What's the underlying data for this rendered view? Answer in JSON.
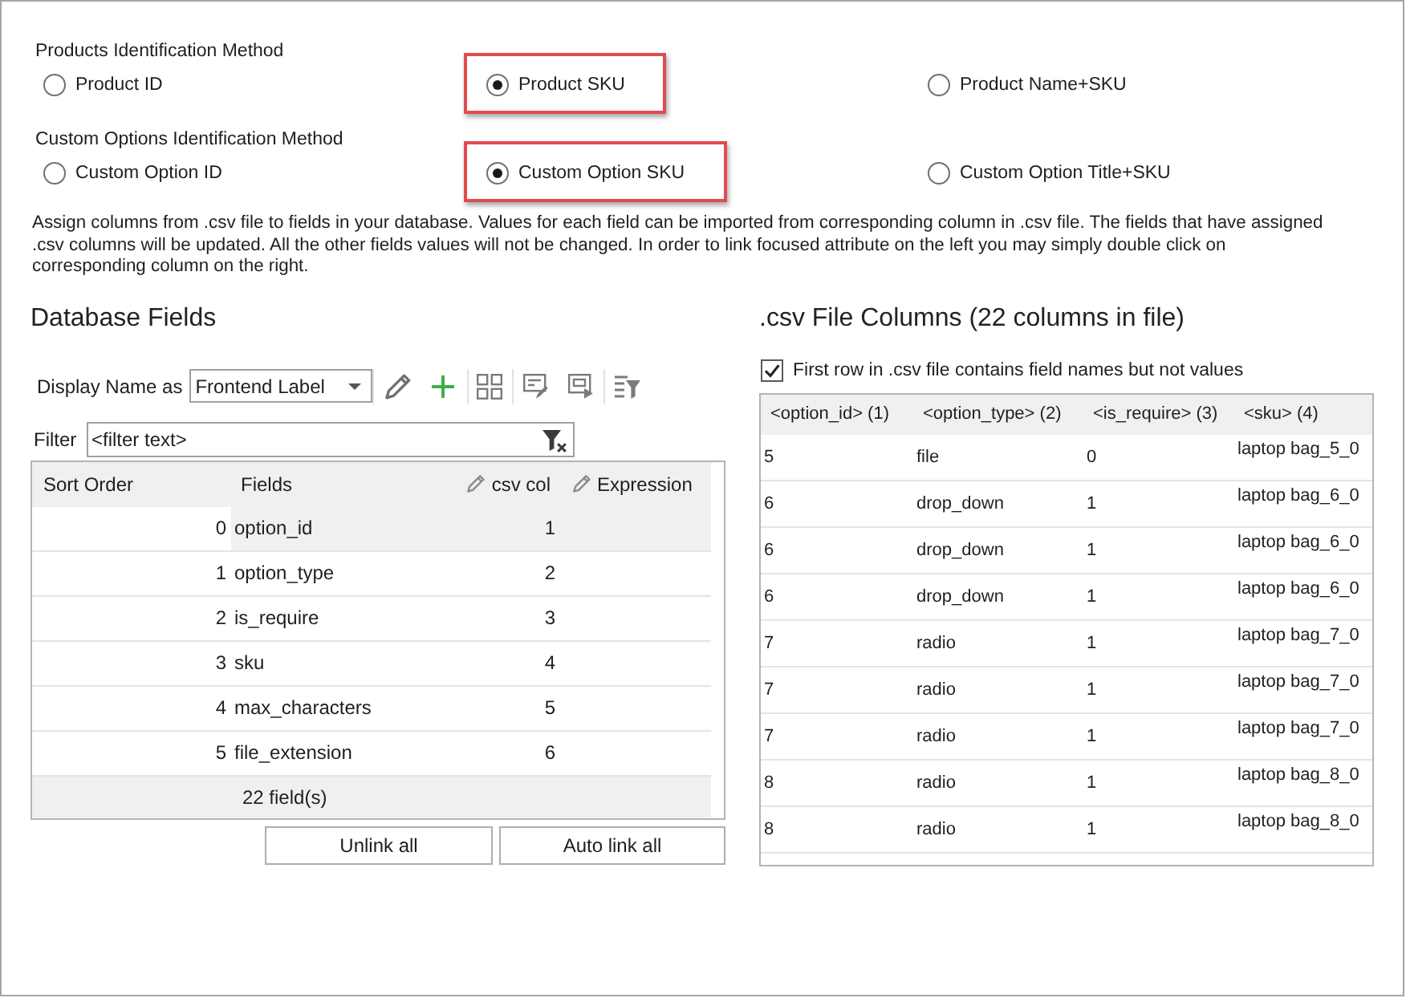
{
  "product_identification": {
    "label": "Products Identification Method",
    "options": [
      {
        "label": "Product ID",
        "selected": false,
        "highlighted": false
      },
      {
        "label": "Product SKU",
        "selected": true,
        "highlighted": true
      },
      {
        "label": "Product Name+SKU",
        "selected": false,
        "highlighted": false
      }
    ]
  },
  "custom_option_identification": {
    "label": "Custom Options Identification Method",
    "options": [
      {
        "label": "Custom Option ID",
        "selected": false,
        "highlighted": false
      },
      {
        "label": "Custom Option SKU",
        "selected": true,
        "highlighted": true
      },
      {
        "label": "Custom Option Title+SKU",
        "selected": false,
        "highlighted": false
      }
    ]
  },
  "instructions": "Assign columns from .csv file to fields in your database. Values for each field can be imported from corresponding column in .csv file. The fields that have assigned .csv columns will be updated. All the other fields values will not be changed. In order to link focused attribute on the left you may simply double click on corresponding column on the right.",
  "database_fields": {
    "title": "Database Fields",
    "display_name": {
      "label": "Display Name as",
      "value": "Frontend Label"
    },
    "filter": {
      "label": "Filter",
      "placeholder": "<filter text>"
    },
    "columns": [
      {
        "label": "Sort Order",
        "editable": false
      },
      {
        "label": "Fields",
        "editable": false
      },
      {
        "label": "csv col",
        "editable": true
      },
      {
        "label": "Expression",
        "editable": true
      }
    ],
    "rows": [
      {
        "sort_order": "0",
        "field": "option_id",
        "csv_col": "1",
        "selected": true
      },
      {
        "sort_order": "1",
        "field": "option_type",
        "csv_col": "2",
        "selected": false
      },
      {
        "sort_order": "2",
        "field": "is_require",
        "csv_col": "3",
        "selected": false
      },
      {
        "sort_order": "3",
        "field": "sku",
        "csv_col": "4",
        "selected": false
      },
      {
        "sort_order": "4",
        "field": "max_characters",
        "csv_col": "5",
        "selected": false
      },
      {
        "sort_order": "5",
        "field": "file_extension",
        "csv_col": "6",
        "selected": false
      }
    ],
    "count": "22 field(s)",
    "buttons": [
      "Unlink all",
      "Auto link all"
    ]
  },
  "csv_columns": {
    "title": ".csv File Columns (22 columns in file)",
    "header_row_option": {
      "label": "First row in .csv file contains field names but not values",
      "checked": true
    },
    "columns": [
      "<option_id> (1)",
      "<option_type> (2)",
      "<is_require> (3)",
      "<sku> (4)"
    ],
    "rows": [
      [
        "5",
        "file",
        "0",
        "laptop bag_5_0"
      ],
      [
        "6",
        "drop_down",
        "1",
        "laptop bag_6_0"
      ],
      [
        "6",
        "drop_down",
        "1",
        "laptop bag_6_0"
      ],
      [
        "6",
        "drop_down",
        "1",
        "laptop bag_6_0"
      ],
      [
        "7",
        "radio",
        "1",
        "laptop bag_7_0"
      ],
      [
        "7",
        "radio",
        "1",
        "laptop bag_7_0"
      ],
      [
        "7",
        "radio",
        "1",
        "laptop bag_7_0"
      ],
      [
        "8",
        "radio",
        "1",
        "laptop bag_8_0"
      ],
      [
        "8",
        "radio",
        "1",
        "laptop bag_8_0"
      ]
    ]
  }
}
